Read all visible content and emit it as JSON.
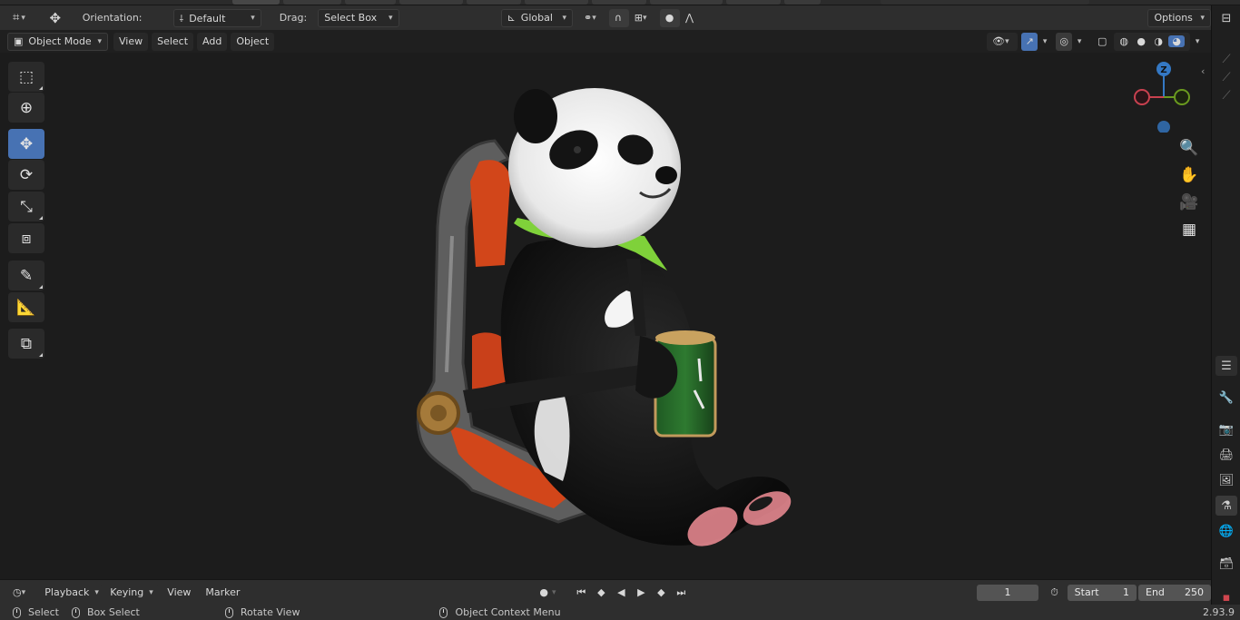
{
  "header": {
    "orientation_label": "Orientation:",
    "orientation_value": "Default",
    "drag_label": "Drag:",
    "drag_value": "Select Box",
    "transform_orientation": "Global",
    "options_label": "Options"
  },
  "view_header": {
    "mode": "Object Mode",
    "menus": [
      "View",
      "Select",
      "Add",
      "Object"
    ]
  },
  "toolbar": {
    "tools": [
      {
        "name": "select-box-tool",
        "icon": "select-box-icon"
      },
      {
        "name": "cursor-tool",
        "icon": "cursor-icon"
      },
      {
        "name": "move-tool",
        "icon": "move-icon",
        "active": true
      },
      {
        "name": "rotate-tool",
        "icon": "rotate-icon"
      },
      {
        "name": "scale-tool",
        "icon": "scale-icon"
      },
      {
        "name": "transform-tool",
        "icon": "transform-icon"
      },
      {
        "name": "annotate-tool",
        "icon": "annotate-icon"
      },
      {
        "name": "measure-tool",
        "icon": "measure-icon"
      },
      {
        "name": "add-cube-tool",
        "icon": "add-cube-icon"
      }
    ]
  },
  "gizmo": {
    "axis_z": "Z"
  },
  "timeline": {
    "menus": [
      "Playback",
      "Keying",
      "View",
      "Marker"
    ],
    "current_frame": "1",
    "start_label": "Start",
    "start_value": "1",
    "end_label": "End",
    "end_value": "250"
  },
  "status": {
    "items": [
      "Select",
      "Box Select",
      "Rotate View",
      "Object Context Menu"
    ],
    "version": "2.93.9"
  },
  "colors": {
    "accent": "#4772b3",
    "axis_x": "#c8414f",
    "axis_y": "#6a9a1f",
    "axis_z": "#3478c4",
    "panda_collar": "#7fd13a",
    "seat_orange": "#d2461a"
  }
}
